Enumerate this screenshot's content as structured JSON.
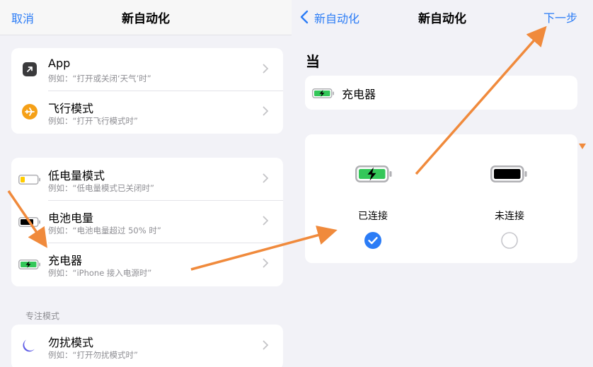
{
  "colors": {
    "accent": "#2b7cf6",
    "annotation": "#f08a3c",
    "battery_green": "#34c759",
    "low_power_yellow": "#ffcc00",
    "plane_orange": "#f5a017",
    "moon_purple": "#5e5ce6"
  },
  "left": {
    "nav": {
      "cancel_label": "取消",
      "title": "新自动化"
    },
    "group1": [
      {
        "icon": "app-arrow-icon",
        "title": "App",
        "subtitle": "例如：“打开或关闭‘天气’时”"
      },
      {
        "icon": "airplane-icon",
        "title": "飞行模式",
        "subtitle": "例如：“打开飞行模式时”"
      }
    ],
    "group2": [
      {
        "icon": "low-power-battery-icon",
        "title": "低电量模式",
        "subtitle": "例如：“低电量模式已关闭时”"
      },
      {
        "icon": "battery-level-icon",
        "title": "电池电量",
        "subtitle": "例如：“电池电量超过 50% 时”"
      },
      {
        "icon": "charging-battery-icon",
        "title": "充电器",
        "subtitle": "例如：“iPhone 接入电源时”"
      }
    ],
    "section_focus_label": "专注模式",
    "group3": [
      {
        "icon": "moon-icon",
        "title": "勿扰模式",
        "subtitle": "例如：“打开勿扰模式时”"
      }
    ]
  },
  "right": {
    "nav": {
      "back_label": "新自动化",
      "title": "新自动化",
      "next_label": "下一步"
    },
    "when_heading": "当",
    "trigger": {
      "icon": "charging-battery-icon",
      "label": "充电器"
    },
    "options": [
      {
        "label": "已连接",
        "selected": true,
        "icon": "charging-battery-icon"
      },
      {
        "label": "未连接",
        "selected": false,
        "icon": "full-battery-icon"
      }
    ]
  }
}
